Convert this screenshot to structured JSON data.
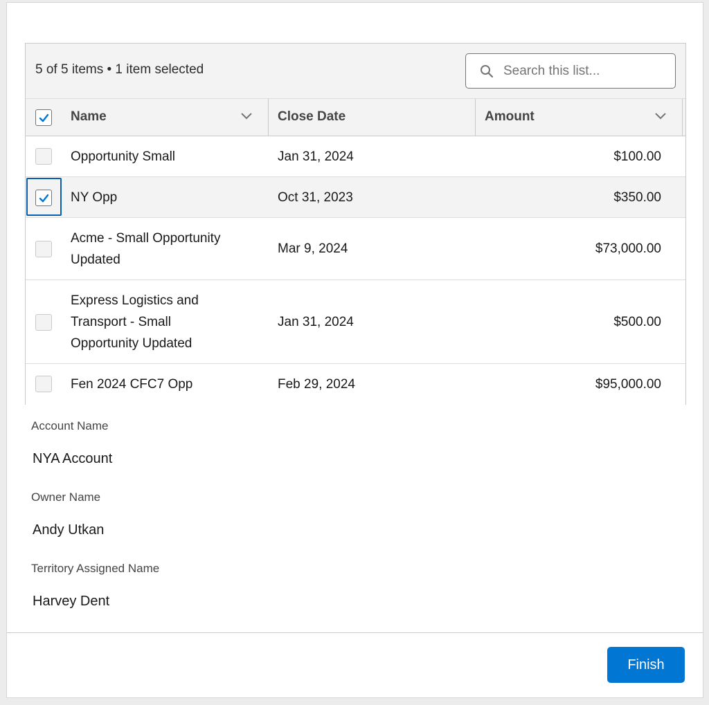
{
  "list": {
    "count_text": "5 of 5 items • 1 item selected",
    "search_placeholder": "Search this list...",
    "search_value": ""
  },
  "columns": {
    "name": "Name",
    "close_date": "Close Date",
    "amount": "Amount"
  },
  "rows": [
    {
      "name": "Opportunity Small",
      "close_date": "Jan 31, 2024",
      "amount": "$100.00",
      "selected": false
    },
    {
      "name": "NY Opp",
      "close_date": "Oct 31, 2023",
      "amount": "$350.00",
      "selected": true
    },
    {
      "name": "Acme - Small Opportunity Updated",
      "close_date": "Mar 9, 2024",
      "amount": "$73,000.00",
      "selected": false
    },
    {
      "name": "Express Logistics and Transport - Small Opportunity Updated",
      "close_date": "Jan 31, 2024",
      "amount": "$500.00",
      "selected": false
    },
    {
      "name": "Fen 2024 CFC7 Opp",
      "close_date": "Feb 29, 2024",
      "amount": "$95,000.00",
      "selected": false
    }
  ],
  "fields": {
    "account_label": "Account Name",
    "account_value": "NYA Account",
    "owner_label": "Owner Name",
    "owner_value": "Andy Utkan",
    "territory_label": "Territory Assigned Name",
    "territory_value": "Harvey Dent"
  },
  "footer": {
    "finish_label": "Finish"
  },
  "colors": {
    "brand": "#0176d3",
    "focus": "#0b5cab"
  }
}
